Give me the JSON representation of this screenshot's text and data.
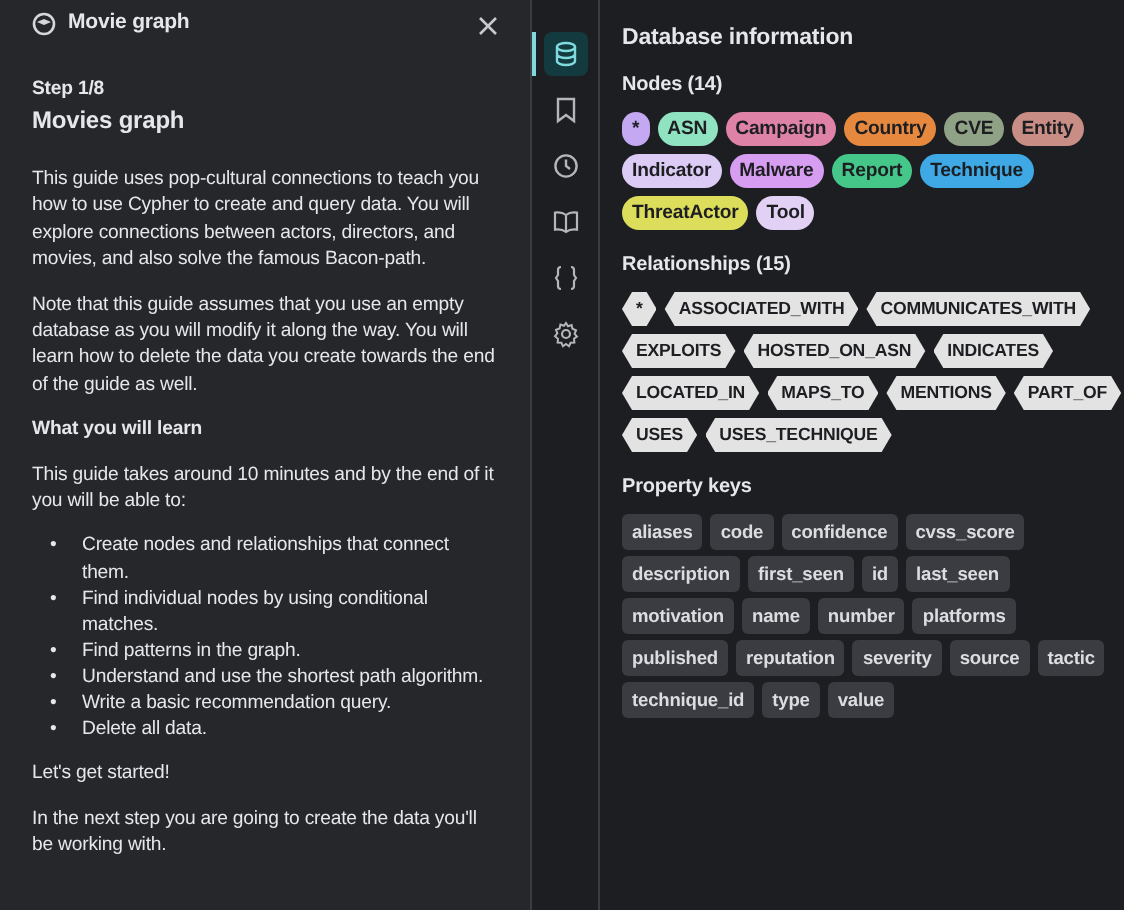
{
  "guide": {
    "title": "Movie graph",
    "step": "Step 1/8",
    "heading": "Movies graph",
    "paragraphs_before": [
      "This guide uses pop-cultural connections to teach you how to use Cypher to create and query data. You will explore connections between actors, directors, and movies, and also solve the famous Bacon-path.",
      "Note that this guide assumes that you use an empty database as you will modify it along the way. You will learn how to delete the data you create towards the end of the guide as well."
    ],
    "subheading": "What you will learn",
    "intro": "This guide takes around 10 minutes and by the end of it you will be able to:",
    "bullet_marker": "•",
    "bullets": [
      "Create nodes and relationships that connect them.",
      "Find individual nodes by using conditional matches.",
      "Find patterns in the graph.",
      "Understand and use the shortest path algorithm.",
      "Write a basic recommendation query.",
      "Delete all data."
    ],
    "paragraphs_after": [
      "Let's get started!",
      "In the next step you are going to create the data you'll be working with."
    ]
  },
  "rail": [
    {
      "selected": true
    },
    {
      "selected": false
    },
    {
      "selected": false
    },
    {
      "selected": false
    },
    {
      "selected": false
    },
    {
      "selected": false
    }
  ],
  "database": {
    "title": "Database information",
    "nodes_heading": "Nodes (14)",
    "nodes": [
      {
        "label": "*",
        "color": "#c5a8f2"
      },
      {
        "label": "ASN",
        "color": "#8fe3c1"
      },
      {
        "label": "Campaign",
        "color": "#de82a7"
      },
      {
        "label": "Country",
        "color": "#e6893f"
      },
      {
        "label": "CVE",
        "color": "#8fa286"
      },
      {
        "label": "Entity",
        "color": "#c88d85"
      },
      {
        "label": "Indicator",
        "color": "#dccbf5"
      },
      {
        "label": "Malware",
        "color": "#d69df0"
      },
      {
        "label": "Report",
        "color": "#46c78a"
      },
      {
        "label": "Technique",
        "color": "#3ea9e4"
      },
      {
        "label": "ThreatActor",
        "color": "#dcdd5a"
      },
      {
        "label": "Tool",
        "color": "#e2d1f5"
      }
    ],
    "relationships_heading": "Relationships (15)",
    "relationships": [
      "*",
      "ASSOCIATED_WITH",
      "COMMUNICATES_WITH",
      "EXPLOITS",
      "HOSTED_ON_ASN",
      "INDICATES",
      "LOCATED_IN",
      "MAPS_TO",
      "MENTIONS",
      "PART_OF",
      "USES",
      "USES_TECHNIQUE"
    ],
    "property_heading": "Property keys",
    "property_keys": [
      "aliases",
      "code",
      "confidence",
      "cvss_score",
      "description",
      "first_seen",
      "id",
      "last_seen",
      "motivation",
      "name",
      "number",
      "platforms",
      "published",
      "reputation",
      "severity",
      "source",
      "tactic",
      "technique_id",
      "type",
      "value"
    ]
  }
}
